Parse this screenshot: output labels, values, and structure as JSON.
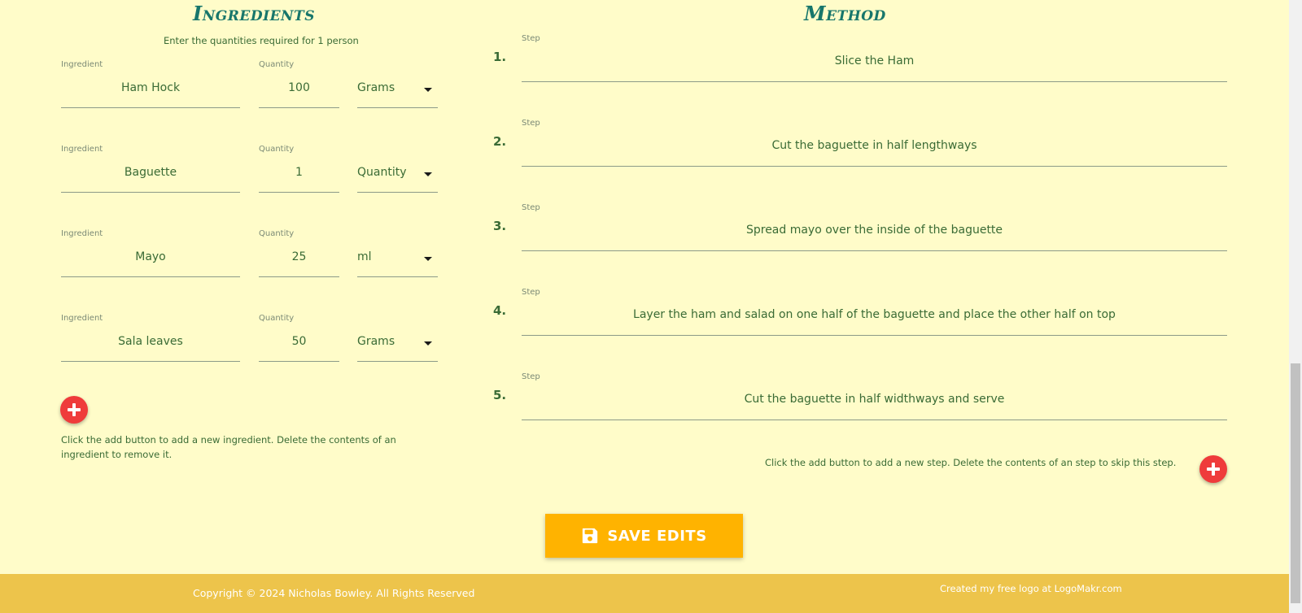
{
  "ingredients": {
    "title": "Ingredients",
    "subtitle": "Enter the quantities required for 1 person",
    "ingredient_label": "Ingredient",
    "quantity_label": "Quantity",
    "rows": [
      {
        "name": "Ham Hock",
        "quantity": "100",
        "unit": "Grams"
      },
      {
        "name": "Baguette",
        "quantity": "1",
        "unit": "Quantity"
      },
      {
        "name": "Mayo",
        "quantity": "25",
        "unit": "ml"
      },
      {
        "name": "Sala leaves",
        "quantity": "50",
        "unit": "Grams"
      }
    ],
    "help": "Click the add button to add a new ingredient. Delete the contents of an ingredient to remove it."
  },
  "method": {
    "title": "Method",
    "step_label": "Step",
    "steps": [
      {
        "number": "1.",
        "text": "Slice the Ham"
      },
      {
        "number": "2.",
        "text": "Cut the baguette in half lengthways"
      },
      {
        "number": "3.",
        "text": "Spread mayo over the inside of the baguette"
      },
      {
        "number": "4.",
        "text": "Layer the ham and salad on one half of the baguette and place the other half on top"
      },
      {
        "number": "5.",
        "text": "Cut the baguette in half widthways and serve"
      }
    ],
    "help": "Click the add button to add a new step. Delete the contents of an step to skip this step."
  },
  "actions": {
    "save_label": "SAVE EDITS"
  },
  "footer": {
    "copyright": "Copyright © 2024 Nicholas Bowley. All Rights Reserved",
    "credit": "Created my free logo at LogoMakr.com"
  },
  "icons": {
    "add": "plus-icon",
    "save": "floppy-disk-icon",
    "dropdown": "caret-down-icon"
  },
  "colors": {
    "background": "#fffcc9",
    "title": "#17766b",
    "text": "#3a6b35",
    "add_button": "#ef3b3b",
    "save_button": "#ffb300",
    "footer": "#edc44b"
  }
}
